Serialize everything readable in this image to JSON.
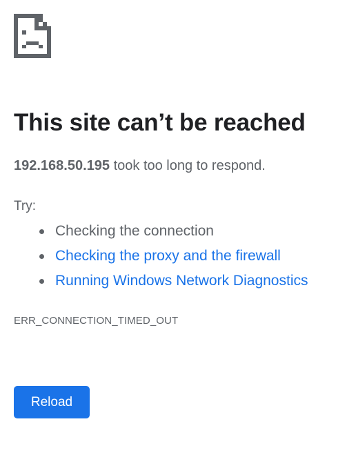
{
  "icon": "sad-page-icon",
  "colors": {
    "link": "#1a73e8",
    "button_bg": "#1a73e8",
    "text_muted": "#5f6368",
    "heading": "#202124"
  },
  "heading": "This site can’t be reached",
  "summary": {
    "host": "192.168.50.195",
    "message": " took too long to respond."
  },
  "try_label": "Try:",
  "suggestions": [
    {
      "label": "Checking the connection",
      "link": false
    },
    {
      "label": "Checking the proxy and the firewall",
      "link": true
    },
    {
      "label": "Running Windows Network Diagnostics",
      "link": true
    }
  ],
  "error_code": "ERR_CONNECTION_TIMED_OUT",
  "reload_label": "Reload"
}
